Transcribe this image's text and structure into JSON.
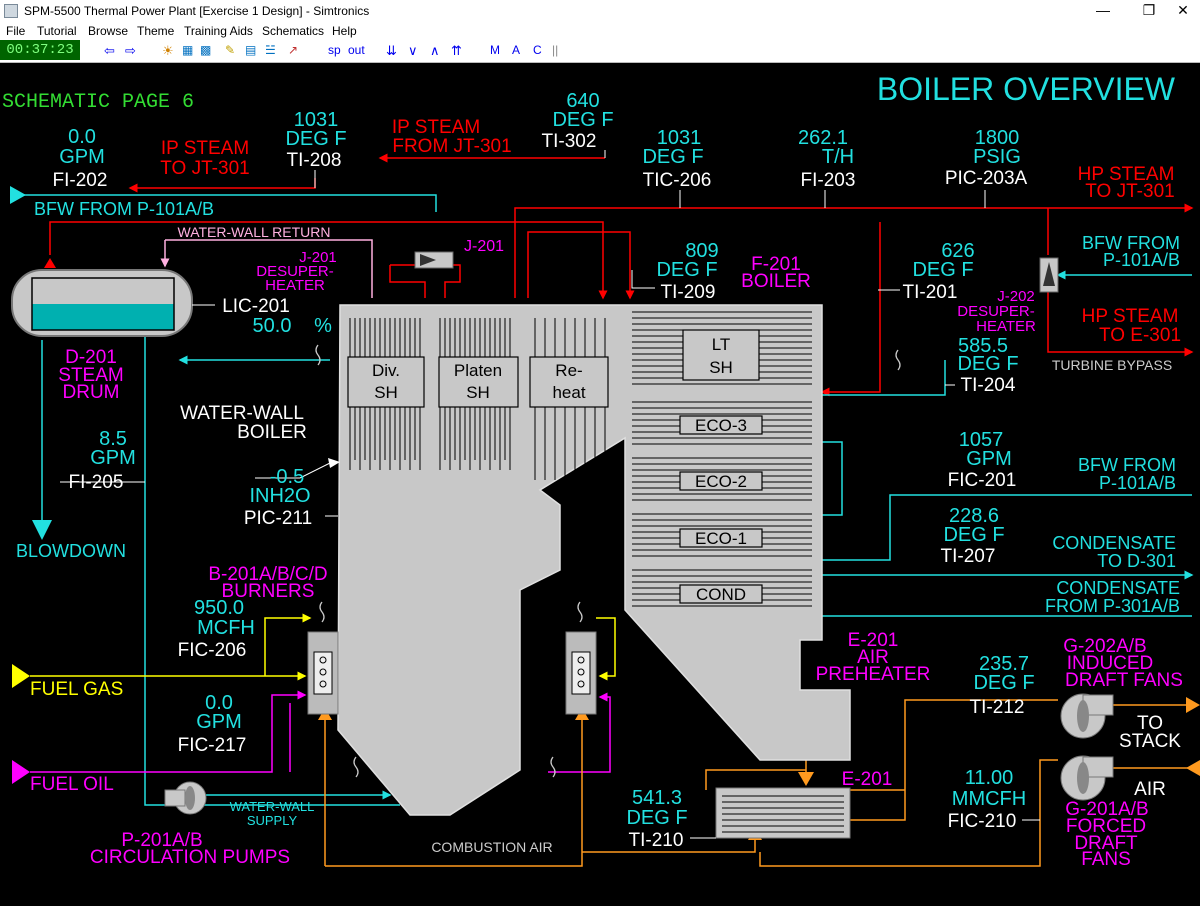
{
  "window": {
    "title": "SPM-5500 Thermal Power Plant [Exercise 1 Design] - Simtronics"
  },
  "menu": [
    "File",
    "Tutorial",
    "Browse",
    "Theme",
    "Training Aids",
    "Schematics",
    "Help"
  ],
  "toolbar": {
    "clock": "00:37:23",
    "sp": "sp",
    "out": "out",
    "m": "M",
    "a": "A",
    "c": "C"
  },
  "page": {
    "label": "SCHEMATIC PAGE 6",
    "title": "BOILER OVERVIEW"
  },
  "instruments": {
    "fi202": {
      "value": "0.0",
      "unit": "GPM",
      "tag": "FI-202"
    },
    "ti208": {
      "value": "1031",
      "unit": "DEG F",
      "tag": "TI-208"
    },
    "ti302": {
      "value": "640",
      "unit": "DEG F",
      "tag": "TI-302"
    },
    "tic206": {
      "value": "1031",
      "unit": "DEG F",
      "tag": "TIC-206"
    },
    "fi203": {
      "value": "262.1",
      "unit": "T/H",
      "tag": "FI-203"
    },
    "pic203a": {
      "value": "1800",
      "unit": "PSIG",
      "tag": "PIC-203A"
    },
    "ti209": {
      "value": "809",
      "unit": "DEG F",
      "tag": "TI-209"
    },
    "ti201": {
      "value": "626",
      "unit": "DEG F",
      "tag": "TI-201"
    },
    "lic201": {
      "value": "50.0",
      "unit": "%",
      "tag": "LIC-201"
    },
    "ti204": {
      "value": "585.5",
      "unit": "DEG F",
      "tag": "TI-204"
    },
    "fi205": {
      "value": "8.5",
      "unit": "GPM",
      "tag": "FI-205"
    },
    "pic211": {
      "value": "-0.5",
      "unit": "INH2O",
      "tag": "PIC-211"
    },
    "fic201": {
      "value": "1057",
      "unit": "GPM",
      "tag": "FIC-201"
    },
    "ti207": {
      "value": "228.6",
      "unit": "DEG F",
      "tag": "TI-207"
    },
    "fic206": {
      "value": "950.0",
      "unit": "MCFH",
      "tag": "FIC-206"
    },
    "ti212": {
      "value": "235.7",
      "unit": "DEG F",
      "tag": "TI-212"
    },
    "fic217": {
      "value": "0.0",
      "unit": "GPM",
      "tag": "FIC-217"
    },
    "ti210": {
      "value": "541.3",
      "unit": "DEG F",
      "tag": "TI-210"
    },
    "fic210": {
      "value": "11.00",
      "unit": "MMCFH",
      "tag": "FIC-210"
    }
  },
  "streams": {
    "ip_to_1": "IP STEAM",
    "ip_to_2": "TO JT-301",
    "ip_from_1": "IP STEAM",
    "ip_from_2": "FROM JT-301",
    "bfw_p101": "BFW FROM P-101A/B",
    "hp_jt_1": "HP STEAM",
    "hp_jt_2": "TO JT-301",
    "bfw_r1_1": "BFW FROM",
    "bfw_r1_2": "P-101A/B",
    "hp_e_1": "HP STEAM",
    "hp_e_2": "TO E-301",
    "turbine_bypass": "TURBINE BYPASS",
    "waterwall_return": "WATER-WALL RETURN",
    "blowdown": "BLOWDOWN",
    "bfw_r2_1": "BFW FROM",
    "bfw_r2_2": "P-101A/B",
    "cond_to_1": "CONDENSATE",
    "cond_to_2": "TO D-301",
    "cond_from_1": "CONDENSATE",
    "cond_from_2": "FROM P-301A/B",
    "fuel_gas": "FUEL GAS",
    "fuel_oil": "FUEL OIL",
    "to_stack_1": "TO",
    "to_stack_2": "STACK",
    "air": "AIR",
    "combustion_air": "COMBUSTION AIR",
    "ww_supply_1": "WATER-WALL",
    "ww_supply_2": "SUPPLY"
  },
  "equipment": {
    "j201_top": "J-201",
    "j201_desup_1": "J-201",
    "j201_desup_2": "DESUPER-",
    "j201_desup_3": "HEATER",
    "j202_1": "J-202",
    "j202_2": "DESUPER-",
    "j202_3": "HEATER",
    "f201_1": "F-201",
    "f201_2": "BOILER",
    "d201_1": "D-201",
    "d201_2": "STEAM",
    "d201_3": "DRUM",
    "waterwall_1": "WATER-WALL",
    "waterwall_2": "BOILER",
    "burners_1": "B-201A/B/C/D",
    "burners_2": "BURNERS",
    "e201_ah_1": "E-201",
    "e201_ah_2": "AIR",
    "e201_ah_3": "PREHEATER",
    "g202_1": "G-202A/B",
    "g202_2": "INDUCED",
    "g202_3": "DRAFT FANS",
    "g201_1": "G-201A/B",
    "g201_2": "FORCED",
    "g201_3": "DRAFT",
    "g201_4": "FANS",
    "e201": "E-201",
    "p201_1": "P-201A/B",
    "p201_2": "CIRCULATION PUMPS",
    "div_1": "Div.",
    "div_2": "SH",
    "platen_1": "Platen",
    "platen_2": "SH",
    "reheat_1": "Re-",
    "reheat_2": "heat",
    "lt_1": "LT",
    "lt_2": "SH",
    "eco3": "ECO-3",
    "eco2": "ECO-2",
    "eco1": "ECO-1",
    "cond": "COND"
  },
  "colors": {
    "cyan": "#22e0e0",
    "red": "#ff0000",
    "yellow": "#ffff00",
    "magenta": "#ff00ff",
    "orange": "#ff9a1f",
    "pink": "#ffb0e0",
    "green": "#33dd33",
    "teal": "#00b0b0"
  }
}
